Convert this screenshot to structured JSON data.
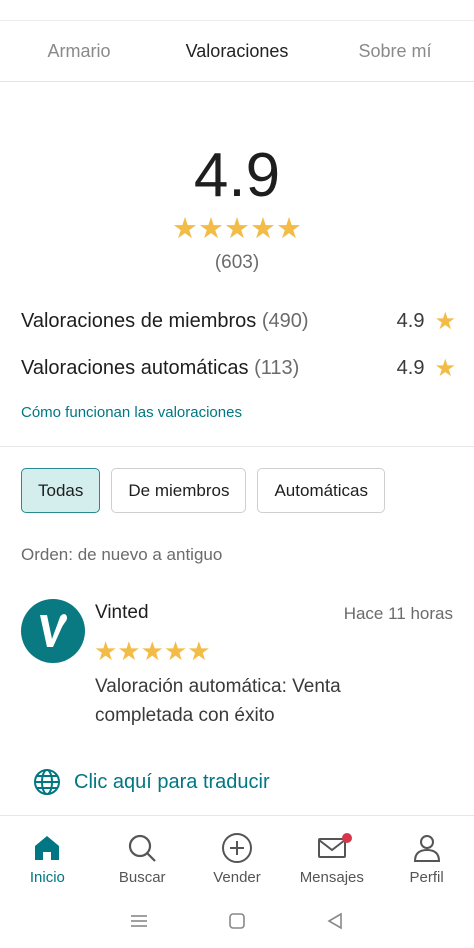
{
  "tabs": [
    {
      "label": "Armario"
    },
    {
      "label": "Valoraciones"
    },
    {
      "label": "Sobre mí"
    }
  ],
  "summary": {
    "score": "4.9",
    "stars": "★★★★★",
    "count": "(603)"
  },
  "breakdown": {
    "members": {
      "label": "Valoraciones de miembros",
      "count": "(490)",
      "score": "4.9",
      "star": "★"
    },
    "automatic": {
      "label": "Valoraciones automáticas",
      "count": "(113)",
      "score": "4.9",
      "star": "★"
    }
  },
  "how_link": "Cómo funcionan las valoraciones",
  "filters": [
    {
      "label": "Todas",
      "selected": true
    },
    {
      "label": "De miembros",
      "selected": false
    },
    {
      "label": "Automáticas",
      "selected": false
    }
  ],
  "order": "Orden: de nuevo a antiguo",
  "review": {
    "name": "Vinted",
    "time": "Hace 11 horas",
    "stars": "★★★★★",
    "text": "Valoración automática: Venta completada con éxito",
    "avatar_icon": "vinted-logo"
  },
  "translate": {
    "label": "Clic aquí para traducir",
    "icon": "globe-icon"
  },
  "nav": [
    {
      "label": "Inicio",
      "icon": "home-icon",
      "active": true
    },
    {
      "label": "Buscar",
      "icon": "search-icon"
    },
    {
      "label": "Vender",
      "icon": "plus-circle-icon"
    },
    {
      "label": "Mensajes",
      "icon": "mail-icon",
      "badge": true
    },
    {
      "label": "Perfil",
      "icon": "person-icon"
    }
  ],
  "colors": {
    "accent": "#007782",
    "star": "#f2bc47",
    "chip_selected_bg": "#d4eeee",
    "badge": "#d6364a"
  }
}
